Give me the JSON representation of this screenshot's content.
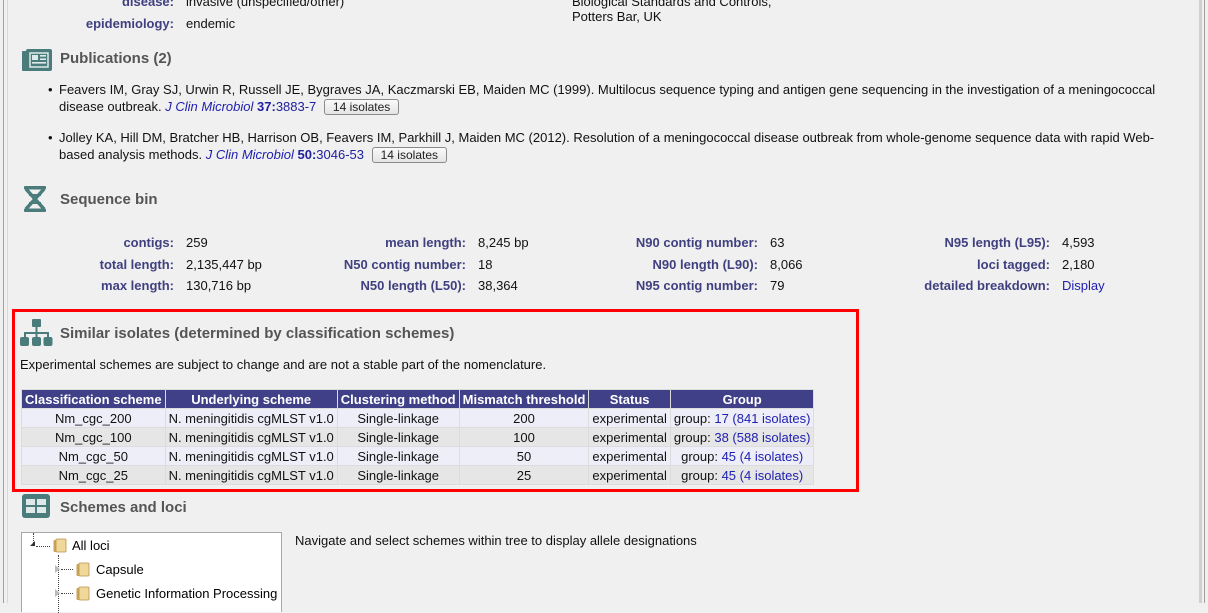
{
  "provenance": {
    "disease_label": "disease:",
    "disease_value": "invasive (unspecified/other)",
    "epidemiology_label": "epidemiology:",
    "epidemiology_value": "endemic",
    "address_line1": "Biological Standards and Controls,",
    "address_line2": "Potters Bar, UK"
  },
  "publications": {
    "title": "Publications (2)",
    "items": [
      {
        "authors_title": "Feavers IM, Gray SJ, Urwin R, Russell JE, Bygraves JA, Kaczmarski EB, Maiden MC (1999). Multilocus sequence typing and antigen gene sequencing in the investigation of a meningococcal disease outbreak.",
        "journal": "J Clin Microbiol",
        "volume": "37:",
        "pages": "3883-7",
        "isolates_button": "14 isolates"
      },
      {
        "authors_title": "Jolley KA, Hill DM, Bratcher HB, Harrison OB, Feavers IM, Parkhill J, Maiden MC (2012). Resolution of a meningococcal disease outbreak from whole-genome sequence data with rapid Web-based analysis methods.",
        "journal": "J Clin Microbiol",
        "volume": "50:",
        "pages": "3046-53",
        "isolates_button": "14 isolates"
      }
    ]
  },
  "sequence_bin": {
    "title": "Sequence bin",
    "stats": [
      {
        "label": "contigs:",
        "value": "259"
      },
      {
        "label": "total length:",
        "value": "2,135,447 bp"
      },
      {
        "label": "max length:",
        "value": "130,716 bp"
      },
      {
        "label": "mean length:",
        "value": "8,245 bp"
      },
      {
        "label": "N50 contig number:",
        "value": "18"
      },
      {
        "label": "N50 length (L50):",
        "value": "38,364"
      },
      {
        "label": "N90 contig number:",
        "value": "63"
      },
      {
        "label": "N90 length (L90):",
        "value": "8,066"
      },
      {
        "label": "N95 contig number:",
        "value": "79"
      },
      {
        "label": "N95 length (L95):",
        "value": "4,593"
      },
      {
        "label": "loci tagged:",
        "value": "2,180"
      },
      {
        "label": "detailed breakdown:",
        "value": "Display"
      }
    ]
  },
  "similar_isolates": {
    "title": "Similar isolates (determined by classification schemes)",
    "note": "Experimental schemes are subject to change and are not a stable part of the nomenclature.",
    "columns": [
      "Classification scheme",
      "Underlying scheme",
      "Clustering method",
      "Mismatch threshold",
      "Status",
      "Group"
    ],
    "rows": [
      {
        "scheme": "Nm_cgc_200",
        "underlying": "N. meningitidis cgMLST v1.0",
        "method": "Single-linkage",
        "threshold": "200",
        "status": "experimental",
        "group_prefix": "group: ",
        "group_link": "17 (841 isolates)"
      },
      {
        "scheme": "Nm_cgc_100",
        "underlying": "N. meningitidis cgMLST v1.0",
        "method": "Single-linkage",
        "threshold": "100",
        "status": "experimental",
        "group_prefix": "group: ",
        "group_link": "38 (588 isolates)"
      },
      {
        "scheme": "Nm_cgc_50",
        "underlying": "N. meningitidis cgMLST v1.0",
        "method": "Single-linkage",
        "threshold": "50",
        "status": "experimental",
        "group_prefix": "group: ",
        "group_link": "45 (4 isolates)"
      },
      {
        "scheme": "Nm_cgc_25",
        "underlying": "N. meningitidis cgMLST v1.0",
        "method": "Single-linkage",
        "threshold": "25",
        "status": "experimental",
        "group_prefix": "group: ",
        "group_link": "45 (4 isolates)"
      }
    ]
  },
  "schemes_loci": {
    "title": "Schemes and loci",
    "tree": [
      "All loci",
      "Capsule",
      "Genetic Information Processing"
    ],
    "hint": "Navigate and select schemes within tree to display allele designations"
  },
  "colors": {
    "label": "#404080",
    "link": "#2020b0",
    "table_header": "#404088",
    "highlight_border": "#ff0000",
    "icon": "#4a7c7c"
  }
}
